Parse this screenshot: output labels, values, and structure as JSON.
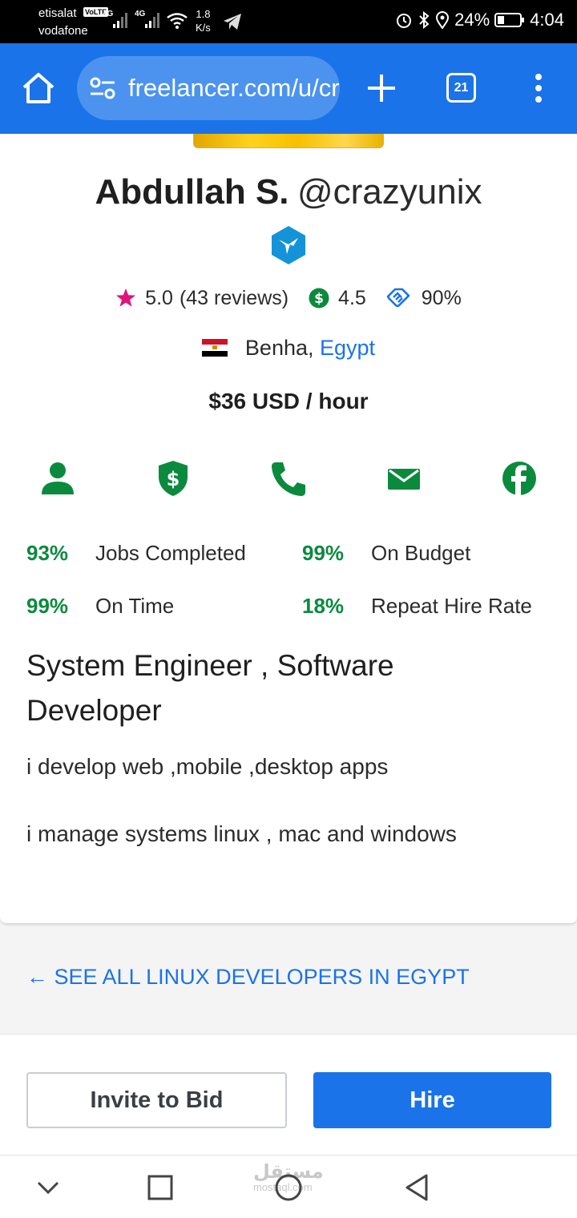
{
  "status_bar": {
    "carrier1": "etisalat",
    "volte": "VoLTE",
    "carrier2": "vodafone",
    "network1": "4G",
    "network2": "4G",
    "speed_value": "1.8",
    "speed_unit": "K/s",
    "battery": "24%",
    "time": "4:04"
  },
  "browser": {
    "url": "freelancer.com/u/crazyunix",
    "tab_count": "21"
  },
  "profile": {
    "name": "Abdullah S.",
    "handle": "@crazyunix",
    "rating": "5.0",
    "reviews": "(43 reviews)",
    "earnings_score": "4.5",
    "completion_rate": "90%",
    "city": "Benha,",
    "country": "Egypt",
    "hourly_rate": "$36 USD / hour"
  },
  "performance": [
    {
      "pct": "93%",
      "label": "Jobs Completed"
    },
    {
      "pct": "99%",
      "label": "On Budget"
    },
    {
      "pct": "99%",
      "label": "On Time"
    },
    {
      "pct": "18%",
      "label": "Repeat Hire Rate"
    }
  ],
  "headline": "System Engineer , Software Developer",
  "description": [
    "i develop web ,mobile ,desktop apps",
    "i manage systems linux , mac and windows"
  ],
  "see_all_link": "← SEE ALL LINUX DEVELOPERS IN EGYPT",
  "actions": {
    "invite": "Invite to Bid",
    "hire": "Hire"
  },
  "watermark": "مستقل",
  "watermark_sub": "mostaql.com",
  "colors": {
    "brand_blue": "#1a73e8",
    "success_green": "#0b8a3e",
    "star_pink": "#e0157a"
  }
}
